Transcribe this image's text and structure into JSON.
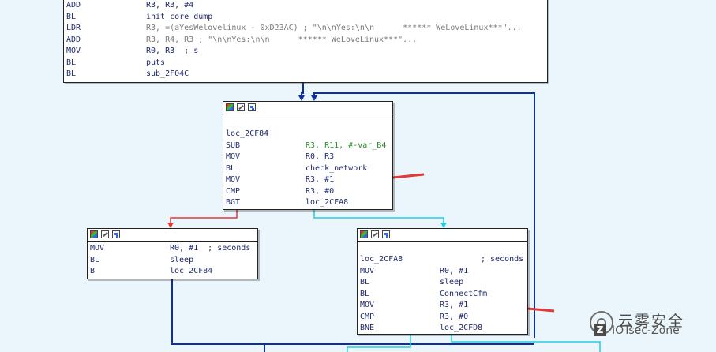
{
  "colors": {
    "background": "#eaf6fb",
    "edge_true": "#22cde2",
    "edge_false": "#e53935",
    "edge_jump": "#0b2fa8",
    "annotation_arrow": "#e53935"
  },
  "top_block": {
    "lines": [
      {
        "mn": "ADD",
        "op": "R3, R3, #4"
      },
      {
        "mn": "BL",
        "op": "init_core_dump"
      },
      {
        "mn": "LDR",
        "op": "R3, =(aYesWelovelinux - 0xD23AC) ; \"\\n\\nYes:\\n\\n      ****** WeLoveLinux***\"..."
      },
      {
        "mn": "ADD",
        "op": "R3, R4, R3 ; \"\\n\\nYes:\\n\\n      ****** WeLoveLinux***\"..."
      },
      {
        "mn": "MOV",
        "op": "R0, R3  ; s"
      },
      {
        "mn": "BL",
        "op": "puts"
      },
      {
        "mn": "BL",
        "op": "sub_2F04C"
      }
    ]
  },
  "loc_2CF84": {
    "label": "loc_2CF84",
    "lines": [
      {
        "mn": "SUB",
        "op": "R3, R11, #-var_B4"
      },
      {
        "mn": "MOV",
        "op": "R0, R3"
      },
      {
        "mn": "BL",
        "op": "check_network"
      },
      {
        "mn": "MOV",
        "op": "R3, #1"
      },
      {
        "mn": "CMP",
        "op": "R3, #0"
      },
      {
        "mn": "BGT",
        "op": "loc_2CFA8"
      }
    ]
  },
  "sleep_block": {
    "lines": [
      {
        "mn": "MOV",
        "op": "R0, #1  ; seconds"
      },
      {
        "mn": "BL",
        "op": "sleep"
      },
      {
        "mn": "B",
        "op": "loc_2CF84"
      }
    ]
  },
  "loc_2CFA8": {
    "label": "loc_2CFA8",
    "label_comment": "; seconds",
    "lines": [
      {
        "mn": "MOV",
        "op": "R0, #1"
      },
      {
        "mn": "BL",
        "op": "sleep"
      },
      {
        "mn": "BL",
        "op": "ConnectCfm"
      },
      {
        "mn": "MOV",
        "op": "R3, #1"
      },
      {
        "mn": "CMP",
        "op": "R3, #0"
      },
      {
        "mn": "BNE",
        "op": "loc_2CFD8"
      }
    ]
  },
  "watermark": {
    "title": "云雾安全",
    "subtitle": "IOTsec-Zone",
    "badge": "Z"
  }
}
